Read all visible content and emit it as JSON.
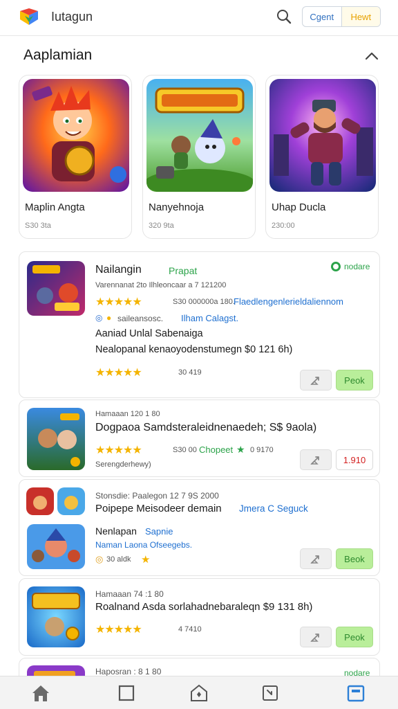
{
  "app": {
    "title": "Iutagun"
  },
  "header": {
    "btn_left": "Cgent",
    "btn_right": "Hewt"
  },
  "section": {
    "title": "Aaplamian"
  },
  "featured": [
    {
      "name": "Maplin Angta",
      "meta": "S30 3ta"
    },
    {
      "name": "Nanyehnoja",
      "meta": "320 9ta"
    },
    {
      "name": "Uhap Ducla",
      "meta": "230:00"
    }
  ],
  "cards": [
    {
      "title": "Nailangin",
      "title_tag": "Prapat",
      "status": "nodare",
      "subtitle": "Varennanat 2to Ilhleoncaar a 7 121200",
      "rating_text": "S30 000000a 180.",
      "rating_link": "Flaedlengenlerieldaliennom",
      "dev": "saileansosc.",
      "dev_link": "Ilham Calagst.",
      "line1": "Aaniad Unlal Sabenaiga",
      "line2": "Nealopanal kenaoyodenstumegn $0 121 6h)",
      "rating2": "30 419",
      "action": "Peok"
    },
    {
      "subtitle": "Hamaaan 120 1 80",
      "title": "Dogpaoa Samdsteraleidnenaedeh; S$ 9aola)",
      "rating_text": "S30 00",
      "rating_link": "Chopeet",
      "rating_tail": "0 9170",
      "dev": "Serengderhewy)",
      "action": "1.910"
    },
    {
      "subtitle": "Stonsdie: Paalegon 12 7 9S 2000",
      "title": "Poipepe Meisodeer demain",
      "title_link": "Jmera C Seguck",
      "sub_title": "Nenlapan",
      "sub_title_tag": "Sapnie",
      "sub_line": "Naman Laona Ofseegebs.",
      "rating": "30 aldk",
      "action": "Beok"
    },
    {
      "subtitle": "Hamaaan 74 :1 80",
      "title": "Roalnand Asda sorlahadnebaraleqn $9 131 8h)",
      "rating": "4 7410",
      "action": "Peok"
    },
    {
      "subtitle": "Haposran : 8 1 80",
      "status": "nodare"
    }
  ],
  "icons": {
    "logo": "logo-icon",
    "search": "search-icon",
    "collapse": "chevron-up-icon",
    "share": "share-icon",
    "nav": [
      "home-icon",
      "square-icon",
      "shop-icon",
      "download-icon",
      "library-icon"
    ]
  },
  "colors": {
    "accent": "#2c7fd6",
    "star": "#f4b400",
    "green": "#2ca34a",
    "price": "#d32020"
  }
}
